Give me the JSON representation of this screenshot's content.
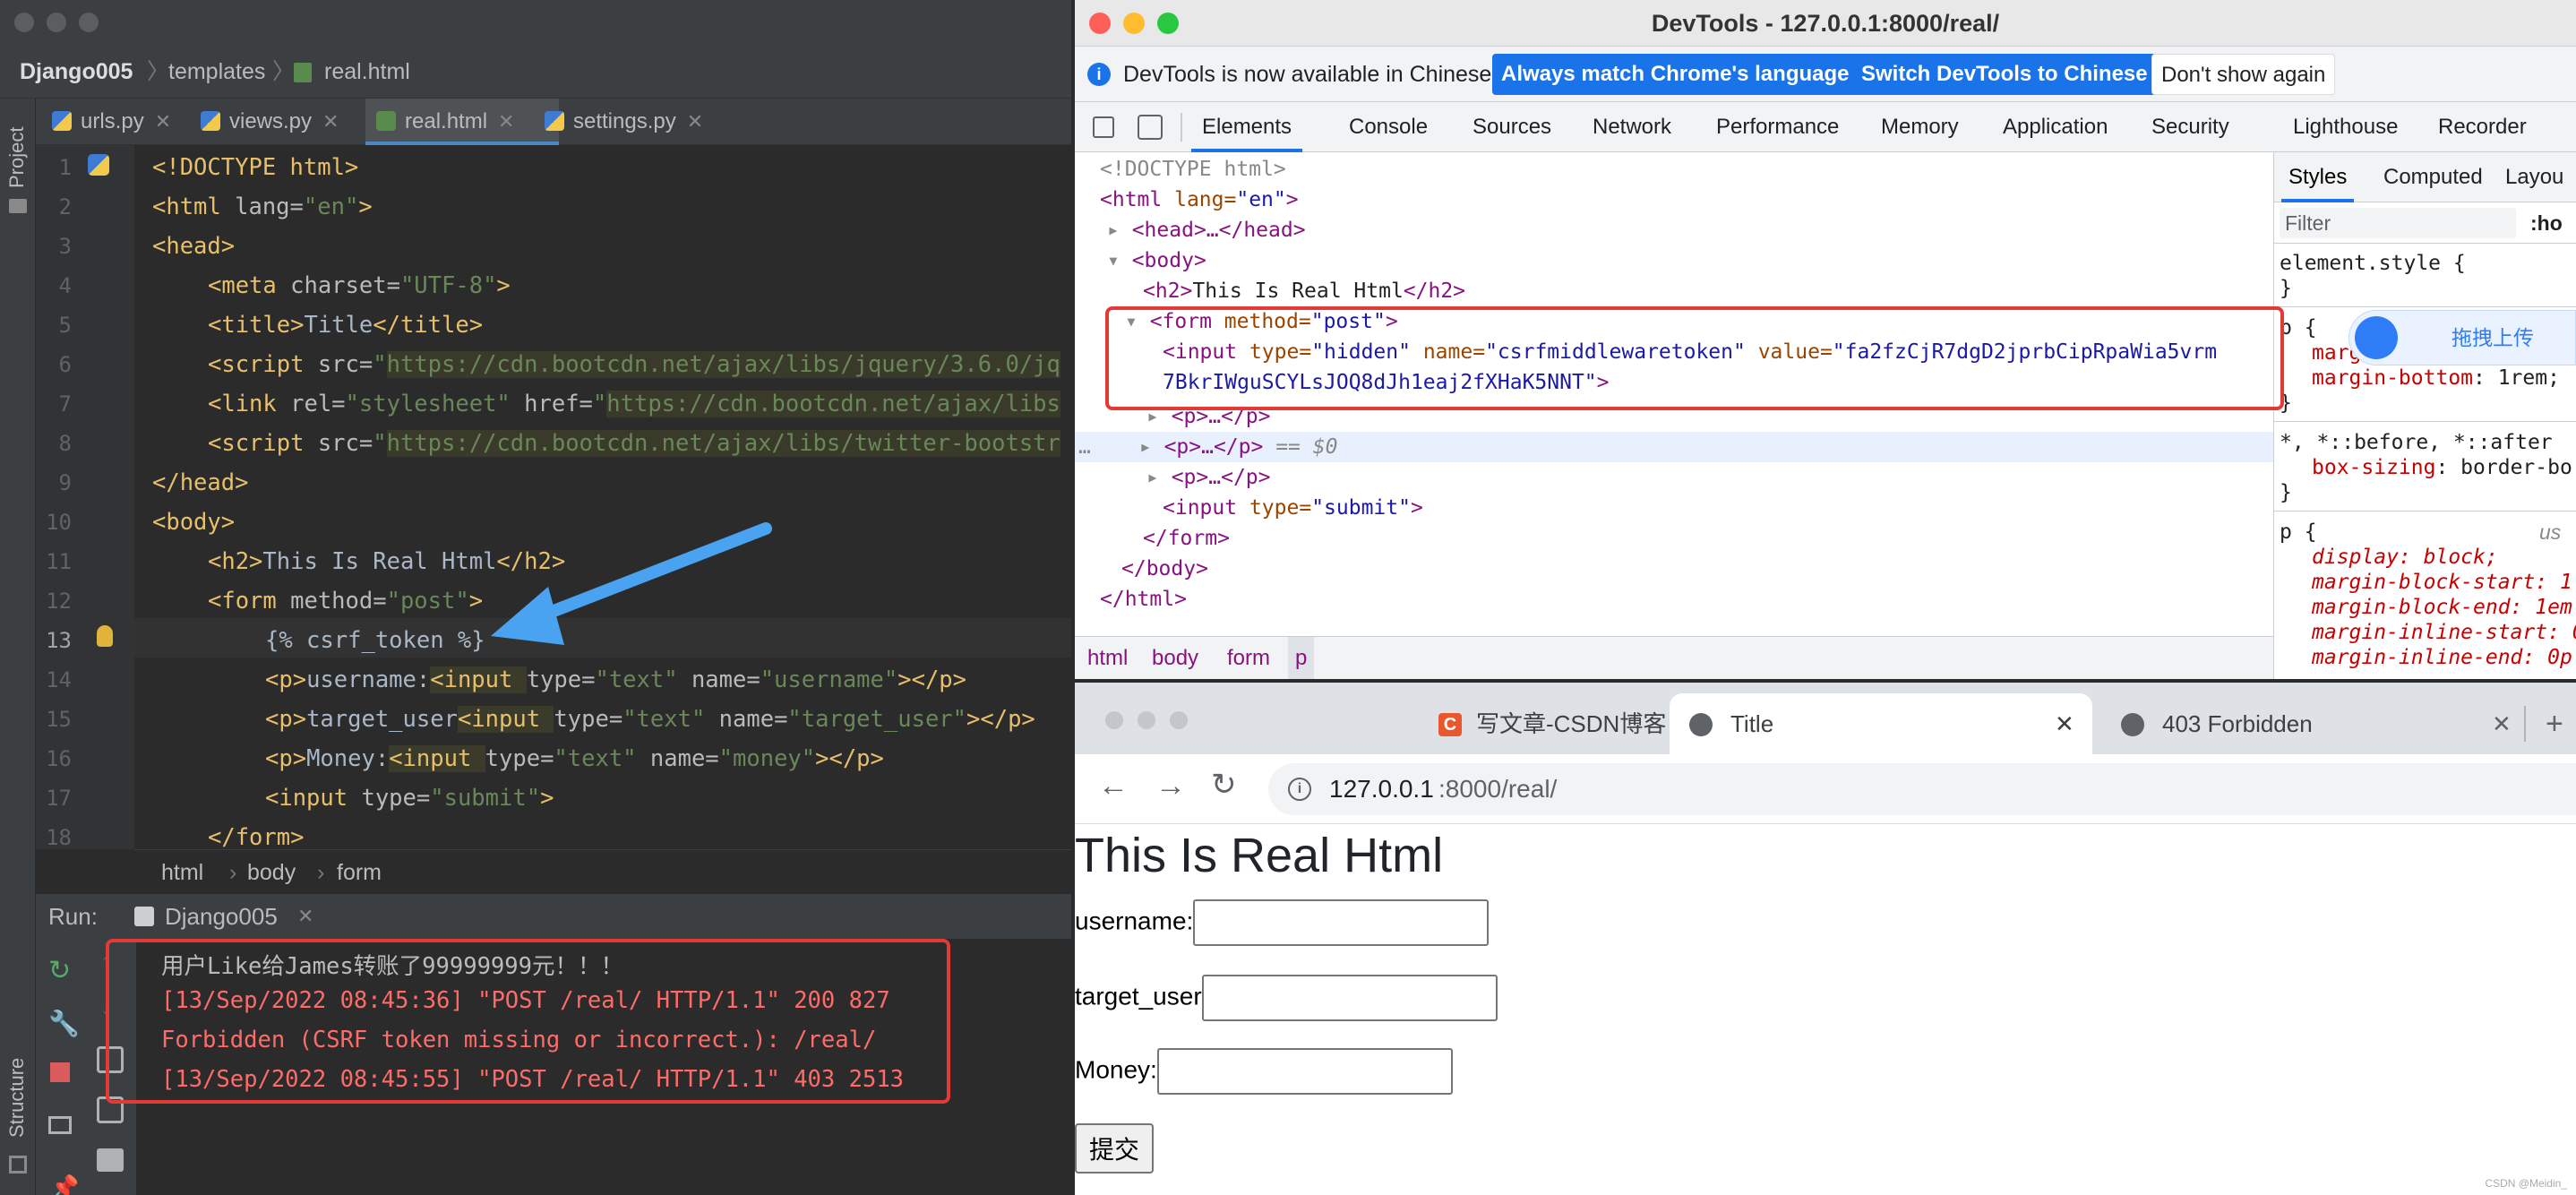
{
  "ide": {
    "breadcrumb": {
      "project": "Django005",
      "folder": "templates",
      "file": "real.html"
    },
    "side_labels": {
      "project": "Project",
      "structure": "Structure"
    },
    "tabs": [
      {
        "label": "urls.py"
      },
      {
        "label": "views.py"
      },
      {
        "label": "real.html",
        "active": true
      },
      {
        "label": "settings.py"
      }
    ],
    "line_numbers": [
      "1",
      "2",
      "3",
      "4",
      "5",
      "6",
      "7",
      "8",
      "9",
      "10",
      "11",
      "12",
      "13",
      "14",
      "15",
      "16",
      "17",
      "18"
    ],
    "code": {
      "l1": "<!DOCTYPE html>",
      "l2_open": "<html ",
      "l2_attr": "lang=",
      "l2_val": "\"en\"",
      "l2_close": ">",
      "l3": "<head>",
      "l4_open": "<meta ",
      "l4_attr": "charset=",
      "l4_val": "\"UTF-8\"",
      "l4_close": ">",
      "l5_open": "<title>",
      "l5_text": "Title",
      "l5_close": "</title>",
      "l6_open": "<script ",
      "l6_attr": "src=",
      "l6_q": "\"",
      "l6_url": "https://cdn.bootcdn.net/ajax/libs/jquery/3.6.0/jq",
      "l7_open": "<link ",
      "l7_attr1": "rel=",
      "l7_val1": "\"stylesheet\" ",
      "l7_attr2": "href=",
      "l7_q": "\"",
      "l7_url": "https://cdn.bootcdn.net/ajax/libs",
      "l8_open": "<script ",
      "l8_attr": "src=",
      "l8_q": "\"",
      "l8_url": "https://cdn.bootcdn.net/ajax/libs/twitter-bootstr",
      "l9": "</head>",
      "l10": "<body>",
      "l11_open": "<h2>",
      "l11_text": "This Is Real Html",
      "l11_close": "</h2>",
      "l12_open": "<form ",
      "l12_attr": "method=",
      "l12_val": "\"post\"",
      "l12_close": ">",
      "l13": "{% csrf_token %}",
      "l14_p": "<p>",
      "l14_text": "username:",
      "l14_in": "<input ",
      "l14_attr1": "type=",
      "l14_val1": "\"text\" ",
      "l14_attr2": "name=",
      "l14_val2": "\"username\"",
      "l14_close": "></p>",
      "l15_p": "<p>",
      "l15_text": "target_user",
      "l15_in": "<input ",
      "l15_attr1": "type=",
      "l15_val1": "\"text\" ",
      "l15_attr2": "name=",
      "l15_val2": "\"target_user\"",
      "l15_close": "></p>",
      "l16_p": "<p>",
      "l16_text": "Money:",
      "l16_in": "<input ",
      "l16_attr1": "type=",
      "l16_val1": "\"text\" ",
      "l16_attr2": "name=",
      "l16_val2": "\"money\"",
      "l16_close": "></p>",
      "l17_in": "<input ",
      "l17_attr": "type=",
      "l17_val": "\"submit\"",
      "l17_close": ">",
      "l18": "</form>"
    },
    "editor_breadcrumb": [
      "html",
      "body",
      "form"
    ],
    "run": {
      "label": "Run:",
      "config": "Django005"
    },
    "console_lines": [
      "用户Like给James转账了99999999元！！！",
      "[13/Sep/2022 08:45:36] \"POST /real/ HTTP/1.1\" 200 827",
      "Forbidden (CSRF token missing or incorrect.): /real/",
      "[13/Sep/2022 08:45:55] \"POST /real/ HTTP/1.1\" 403 2513"
    ]
  },
  "devtools": {
    "title": "DevTools - 127.0.0.1:8000/real/",
    "info_text": "DevTools is now available in Chinese!",
    "buttons": {
      "match": "Always match Chrome's language",
      "switch": "Switch DevTools to Chinese",
      "dismiss": "Don't show again"
    },
    "tabs": [
      "Elements",
      "Console",
      "Sources",
      "Network",
      "Performance",
      "Memory",
      "Application",
      "Security",
      "Lighthouse",
      "Recorder"
    ],
    "dom": {
      "doctype": "<!DOCTYPE html>",
      "html_open": "<html ",
      "html_attr": "lang=",
      "html_val": "\"en\"",
      "html_close": ">",
      "head": "<head>…</head>",
      "body_open": "<body>",
      "h2_open": "<h2>",
      "h2_text": "This Is Real Html",
      "h2_close": "</h2>",
      "form_open": "<form ",
      "form_attr": "method=",
      "form_val": "\"post\"",
      "form_close": ">",
      "input_open": "<input ",
      "input_a1": "type=",
      "input_v1": "\"hidden\" ",
      "input_a2": "name=",
      "input_v2": "\"csrfmiddlewaretoken\" ",
      "input_a3": "value=",
      "input_v3a": "\"fa2fzCjR7dgD2jprbCipRpaWia5vrm",
      "input_v3b": "7BkrIWguSCYLsJOQ8dJh1eaj2fXHaK5NNT\"",
      "input_close": ">",
      "p_collapsed": "<p>…</p>",
      "selected_suffix": " == $0",
      "submit_open": "<input ",
      "submit_attr": "type=",
      "submit_val": "\"submit\"",
      "submit_close": ">",
      "form_end": "</form>",
      "body_end": "</body>",
      "html_end": "</html>"
    },
    "crumbs": [
      "html",
      "body",
      "form",
      "p"
    ],
    "styles_tabs": [
      "Styles",
      "Computed",
      "Layou"
    ],
    "filter_placeholder": "Filter",
    "hov": ":ho",
    "styles": {
      "element_style": "element.style {",
      "close": "}",
      "p_sel": "p {",
      "p_mb_prop": "margin-bottom",
      "p_mb_val": ": 1rem;",
      "p_mt_partial": "margin-top: 0;",
      "universal": "*, *::before, *::after",
      "box_prop": "box-sizing",
      "box_val": ": border-bo",
      "ua_p": "p {",
      "ua_label": "us",
      "ua_lines": [
        "display: block;",
        "margin-block-start: 1",
        "margin-block-end: 1em",
        "margin-inline-start: 0",
        "margin-inline-end: 0p"
      ]
    },
    "upload_label": "拖拽上传"
  },
  "browser": {
    "tabs": [
      {
        "title": "写文章-CSDN博客"
      },
      {
        "title": "Title",
        "active": true
      },
      {
        "title": "403 Forbidden"
      }
    ],
    "url_host": "127.0.0.1",
    "url_rest": ":8000/real/",
    "page": {
      "heading": "This Is Real Html",
      "username_label": "username:",
      "target_label": "target_user",
      "money_label": "Money:",
      "submit": "提交"
    },
    "watermark": "CSDN @Meidin_"
  },
  "colors": {
    "accent_blue": "#1a73e8",
    "highlight_red": "#e53935",
    "arrow_blue": "#4aa3f0"
  }
}
